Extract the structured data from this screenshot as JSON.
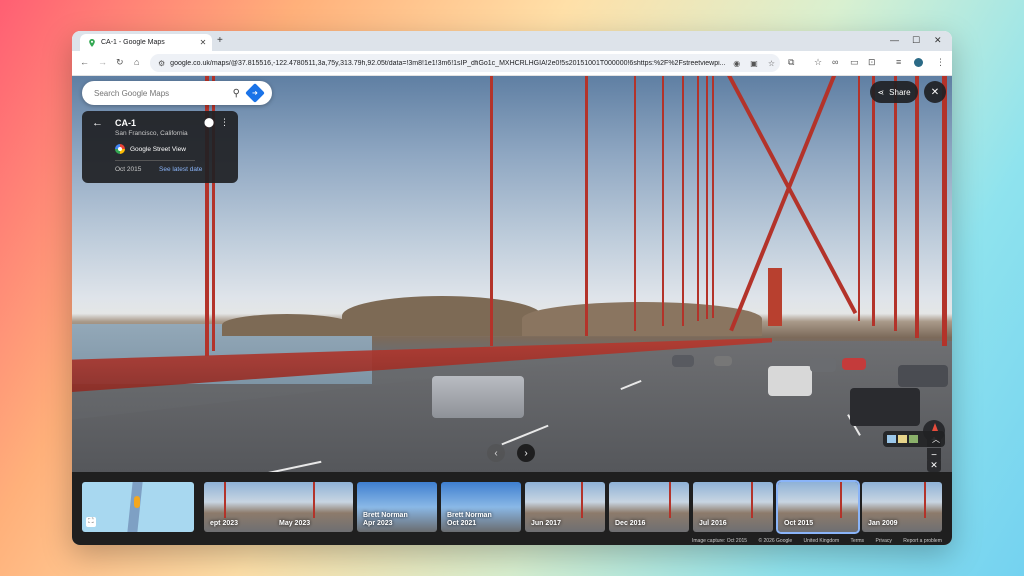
{
  "browser": {
    "tab_title": "CA-1 - Google Maps",
    "url": "google.co.uk/maps/@37.815516,-122.4780511,3a,75y,313.79h,92.05t/data=!3m8!1e1!3m6!1sIP_dfiGo1c_MXHCRLHGIA!2e0!5s20151001T000000!6shttps:%2F%2Fstreetviewpi..."
  },
  "search": {
    "placeholder": "Search Google Maps"
  },
  "location_card": {
    "name": "CA-1",
    "subtitle": "San Francisco, California",
    "source": "Google Street View",
    "date": "Oct 2015",
    "latest_link": "See latest date"
  },
  "actions": {
    "share_label": "Share"
  },
  "timeline": [
    {
      "label": "ept 2023",
      "author": ""
    },
    {
      "label": "May 2023",
      "author": ""
    },
    {
      "label": "Apr 2023",
      "author": "Brett Norman"
    },
    {
      "label": "Oct 2021",
      "author": "Brett Norman"
    },
    {
      "label": "Jun 2017",
      "author": ""
    },
    {
      "label": "Dec 2016",
      "author": ""
    },
    {
      "label": "Jul 2016",
      "author": ""
    },
    {
      "label": "Oct 2015",
      "author": ""
    },
    {
      "label": "Jan 2009",
      "author": ""
    }
  ],
  "footer": {
    "capture": "Image capture: Oct 2015",
    "copyright": "© 2026 Google",
    "region": "United Kingdom",
    "terms": "Terms",
    "privacy": "Privacy",
    "report": "Report a problem"
  },
  "colors": {
    "accent": "#1a73e8",
    "link": "#8ab4f8",
    "bridge_red": "#b3332a"
  }
}
